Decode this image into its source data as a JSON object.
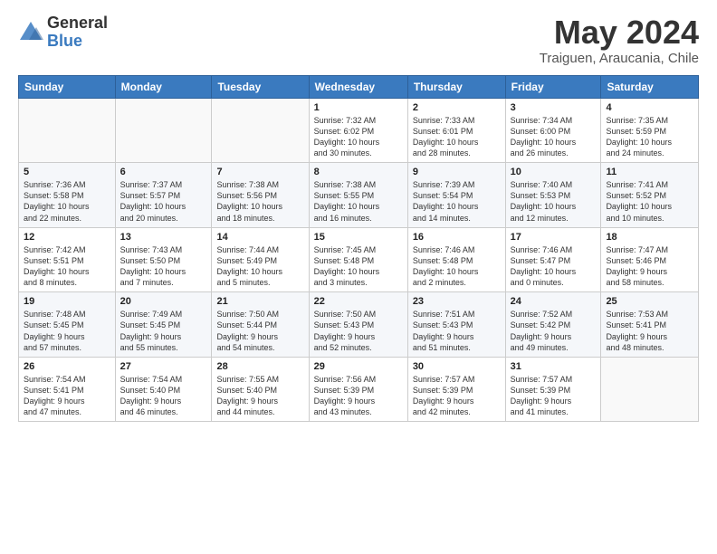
{
  "header": {
    "logo_general": "General",
    "logo_blue": "Blue",
    "month_year": "May 2024",
    "location": "Traiguen, Araucania, Chile"
  },
  "weekdays": [
    "Sunday",
    "Monday",
    "Tuesday",
    "Wednesday",
    "Thursday",
    "Friday",
    "Saturday"
  ],
  "weeks": [
    [
      {
        "day": "",
        "info": ""
      },
      {
        "day": "",
        "info": ""
      },
      {
        "day": "",
        "info": ""
      },
      {
        "day": "1",
        "info": "Sunrise: 7:32 AM\nSunset: 6:02 PM\nDaylight: 10 hours\nand 30 minutes."
      },
      {
        "day": "2",
        "info": "Sunrise: 7:33 AM\nSunset: 6:01 PM\nDaylight: 10 hours\nand 28 minutes."
      },
      {
        "day": "3",
        "info": "Sunrise: 7:34 AM\nSunset: 6:00 PM\nDaylight: 10 hours\nand 26 minutes."
      },
      {
        "day": "4",
        "info": "Sunrise: 7:35 AM\nSunset: 5:59 PM\nDaylight: 10 hours\nand 24 minutes."
      }
    ],
    [
      {
        "day": "5",
        "info": "Sunrise: 7:36 AM\nSunset: 5:58 PM\nDaylight: 10 hours\nand 22 minutes."
      },
      {
        "day": "6",
        "info": "Sunrise: 7:37 AM\nSunset: 5:57 PM\nDaylight: 10 hours\nand 20 minutes."
      },
      {
        "day": "7",
        "info": "Sunrise: 7:38 AM\nSunset: 5:56 PM\nDaylight: 10 hours\nand 18 minutes."
      },
      {
        "day": "8",
        "info": "Sunrise: 7:38 AM\nSunset: 5:55 PM\nDaylight: 10 hours\nand 16 minutes."
      },
      {
        "day": "9",
        "info": "Sunrise: 7:39 AM\nSunset: 5:54 PM\nDaylight: 10 hours\nand 14 minutes."
      },
      {
        "day": "10",
        "info": "Sunrise: 7:40 AM\nSunset: 5:53 PM\nDaylight: 10 hours\nand 12 minutes."
      },
      {
        "day": "11",
        "info": "Sunrise: 7:41 AM\nSunset: 5:52 PM\nDaylight: 10 hours\nand 10 minutes."
      }
    ],
    [
      {
        "day": "12",
        "info": "Sunrise: 7:42 AM\nSunset: 5:51 PM\nDaylight: 10 hours\nand 8 minutes."
      },
      {
        "day": "13",
        "info": "Sunrise: 7:43 AM\nSunset: 5:50 PM\nDaylight: 10 hours\nand 7 minutes."
      },
      {
        "day": "14",
        "info": "Sunrise: 7:44 AM\nSunset: 5:49 PM\nDaylight: 10 hours\nand 5 minutes."
      },
      {
        "day": "15",
        "info": "Sunrise: 7:45 AM\nSunset: 5:48 PM\nDaylight: 10 hours\nand 3 minutes."
      },
      {
        "day": "16",
        "info": "Sunrise: 7:46 AM\nSunset: 5:48 PM\nDaylight: 10 hours\nand 2 minutes."
      },
      {
        "day": "17",
        "info": "Sunrise: 7:46 AM\nSunset: 5:47 PM\nDaylight: 10 hours\nand 0 minutes."
      },
      {
        "day": "18",
        "info": "Sunrise: 7:47 AM\nSunset: 5:46 PM\nDaylight: 9 hours\nand 58 minutes."
      }
    ],
    [
      {
        "day": "19",
        "info": "Sunrise: 7:48 AM\nSunset: 5:45 PM\nDaylight: 9 hours\nand 57 minutes."
      },
      {
        "day": "20",
        "info": "Sunrise: 7:49 AM\nSunset: 5:45 PM\nDaylight: 9 hours\nand 55 minutes."
      },
      {
        "day": "21",
        "info": "Sunrise: 7:50 AM\nSunset: 5:44 PM\nDaylight: 9 hours\nand 54 minutes."
      },
      {
        "day": "22",
        "info": "Sunrise: 7:50 AM\nSunset: 5:43 PM\nDaylight: 9 hours\nand 52 minutes."
      },
      {
        "day": "23",
        "info": "Sunrise: 7:51 AM\nSunset: 5:43 PM\nDaylight: 9 hours\nand 51 minutes."
      },
      {
        "day": "24",
        "info": "Sunrise: 7:52 AM\nSunset: 5:42 PM\nDaylight: 9 hours\nand 49 minutes."
      },
      {
        "day": "25",
        "info": "Sunrise: 7:53 AM\nSunset: 5:41 PM\nDaylight: 9 hours\nand 48 minutes."
      }
    ],
    [
      {
        "day": "26",
        "info": "Sunrise: 7:54 AM\nSunset: 5:41 PM\nDaylight: 9 hours\nand 47 minutes."
      },
      {
        "day": "27",
        "info": "Sunrise: 7:54 AM\nSunset: 5:40 PM\nDaylight: 9 hours\nand 46 minutes."
      },
      {
        "day": "28",
        "info": "Sunrise: 7:55 AM\nSunset: 5:40 PM\nDaylight: 9 hours\nand 44 minutes."
      },
      {
        "day": "29",
        "info": "Sunrise: 7:56 AM\nSunset: 5:39 PM\nDaylight: 9 hours\nand 43 minutes."
      },
      {
        "day": "30",
        "info": "Sunrise: 7:57 AM\nSunset: 5:39 PM\nDaylight: 9 hours\nand 42 minutes."
      },
      {
        "day": "31",
        "info": "Sunrise: 7:57 AM\nSunset: 5:39 PM\nDaylight: 9 hours\nand 41 minutes."
      },
      {
        "day": "",
        "info": ""
      }
    ]
  ]
}
